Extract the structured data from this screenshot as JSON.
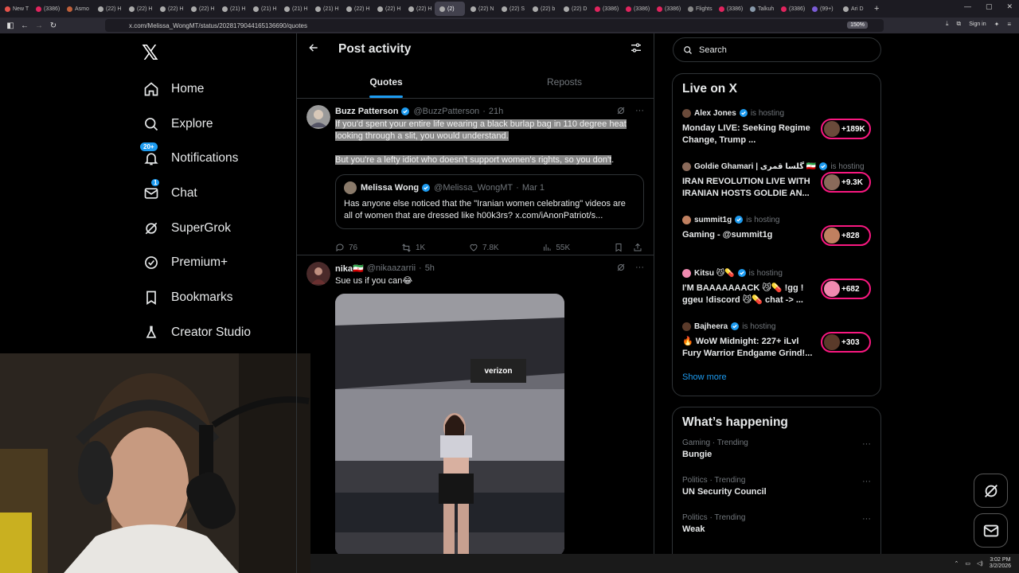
{
  "browser": {
    "tabs": [
      {
        "label": "New T",
        "color": "#e5534b"
      },
      {
        "label": "(3386)",
        "color": "#e0245e"
      },
      {
        "label": "Asmo",
        "color": "#c0603a"
      },
      {
        "label": "(22) H",
        "color": "#aaaaaa"
      },
      {
        "label": "(22) H",
        "color": "#aaaaaa"
      },
      {
        "label": "(22) H",
        "color": "#aaaaaa"
      },
      {
        "label": "(22) H",
        "color": "#aaaaaa"
      },
      {
        "label": "(21) H",
        "color": "#aaaaaa"
      },
      {
        "label": "(21) H",
        "color": "#aaaaaa"
      },
      {
        "label": "(21) H",
        "color": "#aaaaaa"
      },
      {
        "label": "(21) H",
        "color": "#aaaaaa"
      },
      {
        "label": "(22) H",
        "color": "#aaaaaa"
      },
      {
        "label": "(22) H",
        "color": "#aaaaaa"
      },
      {
        "label": "(22) H",
        "color": "#aaaaaa"
      },
      {
        "label": "(2)",
        "color": "#aaaaaa"
      },
      {
        "label": "(22) N",
        "color": "#aaaaaa"
      },
      {
        "label": "(22) S",
        "color": "#aaaaaa"
      },
      {
        "label": "(22) b",
        "color": "#aaaaaa"
      },
      {
        "label": "(22) D",
        "color": "#aaaaaa"
      },
      {
        "label": "(3386)",
        "color": "#e0245e"
      },
      {
        "label": "(3386)",
        "color": "#e0245e"
      },
      {
        "label": "(3386)",
        "color": "#e0245e"
      },
      {
        "label": "Flights",
        "color": "#888888"
      },
      {
        "label": "(3386)",
        "color": "#e0245e"
      },
      {
        "label": "Talkuh",
        "color": "#8899aa"
      },
      {
        "label": "(3386)",
        "color": "#e0245e"
      },
      {
        "label": "(99+)",
        "color": "#7b5cd6"
      },
      {
        "label": "Ari D",
        "color": "#aaaaaa"
      }
    ],
    "active_tab_index": 14,
    "new_tab": "+",
    "url": "x.com/Melissa_WongMT/status/2028179044165136690/quotes",
    "zoom": "150%",
    "sign_in": "Sign in"
  },
  "sidebar": {
    "logo": "𝕏",
    "items": [
      {
        "label": "Home",
        "icon": "home-icon"
      },
      {
        "label": "Explore",
        "icon": "search-icon"
      },
      {
        "label": "Notifications",
        "icon": "bell-icon",
        "badge": "20+"
      },
      {
        "label": "Chat",
        "icon": "mail-icon",
        "badge": "1"
      },
      {
        "label": "SuperGrok",
        "icon": "grok-icon"
      },
      {
        "label": "Premium+",
        "icon": "verified-icon"
      },
      {
        "label": "Bookmarks",
        "icon": "bookmark-icon"
      },
      {
        "label": "Creator Studio",
        "icon": "flask-icon"
      }
    ]
  },
  "main": {
    "title": "Post activity",
    "tabs": [
      {
        "label": "Quotes",
        "active": true
      },
      {
        "label": "Reposts",
        "active": false
      }
    ],
    "posts": [
      {
        "name": "Buzz Patterson",
        "handle": "@BuzzPatterson",
        "time": "21h",
        "text1": "If you'd spent your entire life wearing a black burlap bag in 110 degree heat looking through a slit, you would understand.",
        "text2": "But you're a lefty idiot who doesn't support women's rights, so you don't",
        "text2_end": ".",
        "quote": {
          "name": "Melissa Wong",
          "handle": "@Melissa_WongMT",
          "time": "Mar 1",
          "text": "Has anyone else noticed that the \"Iranian women celebrating\" videos are all of women that are dressed like h00k3rs? x.com/iAnonPatriot/s..."
        },
        "replies": "76",
        "reposts": "1K",
        "likes": "7.8K",
        "views": "55K"
      },
      {
        "name": "nika🇮🇷",
        "handle": "@nikaazarrii",
        "time": "5h",
        "text": "Sue us if you can😂",
        "photo_text": "verizon"
      }
    ]
  },
  "right": {
    "search_placeholder": "Search",
    "live_title": "Live on X",
    "hosting": "is hosting",
    "live": [
      {
        "name": "Alex Jones",
        "title": "Monday LIVE: Seeking Regime Change, Trump ...",
        "count": "+189K",
        "color": "#6a4a3a"
      },
      {
        "name": "Goldie Ghamari | گلسا قمری 🇮🇷",
        "title": "IRAN REVOLUTION LIVE WITH IRANIAN HOSTS GOLDIE AN...",
        "count": "+9.3K",
        "color": "#8a6a5a"
      },
      {
        "name": "summit1g",
        "title": "Gaming - @summit1g",
        "count": "+828",
        "color": "#c08060"
      },
      {
        "name": "Kitsu 😼💊",
        "title": "I'M BAAAAAAACK 😼💊 !gg ! ggeu !discord 😼💊 chat -> ...",
        "count": "+682",
        "color": "#f08ab0"
      },
      {
        "name": "Bajheera",
        "title": "🔥 WoW Midnight: 227+ iLvl Fury Warrior Endgame Grind!...",
        "count": "+303",
        "color": "#5a3a2a"
      }
    ],
    "show_more": "Show more",
    "happening_title": "What’s happening",
    "trends": [
      {
        "category": "Gaming · Trending",
        "name": "Bungie"
      },
      {
        "category": "Politics · Trending",
        "name": "UN Security Council"
      },
      {
        "category": "Politics · Trending",
        "name": "Weak"
      }
    ],
    "more": "···"
  },
  "taskbar": {
    "time": "3:02 PM",
    "date": "3/2/2026"
  }
}
